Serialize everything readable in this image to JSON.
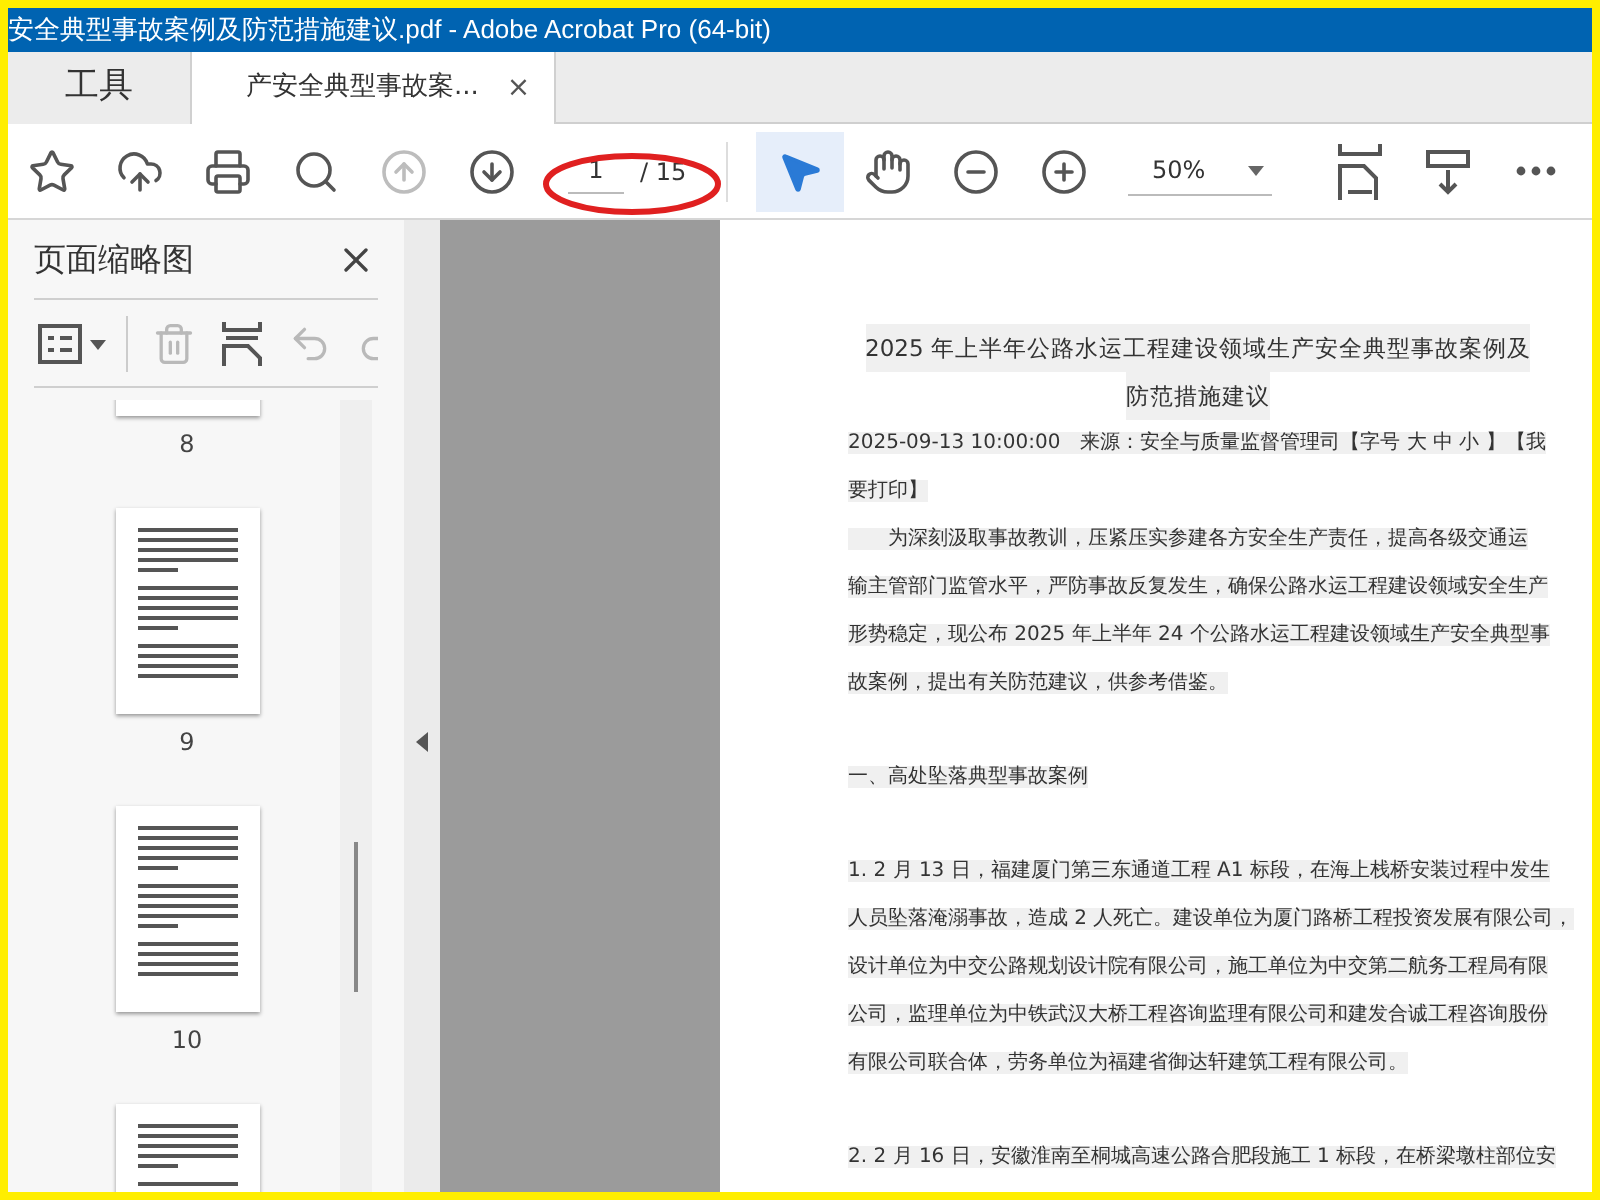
{
  "window": {
    "title": "安全典型事故案例及防范措施建议.pdf - Adobe Acrobat Pro (64-bit)"
  },
  "tabs": [
    {
      "label": "工具",
      "selected": false
    },
    {
      "label": "产安全典型事故案...",
      "selected": true,
      "close": "×"
    }
  ],
  "toolbar": {
    "tools": [
      {
        "kind": "star",
        "selected": false,
        "disabled": false
      },
      {
        "kind": "upload",
        "selected": false,
        "disabled": false
      },
      {
        "kind": "print",
        "selected": false,
        "disabled": false
      },
      {
        "kind": "find",
        "selected": false,
        "disabled": false
      },
      {
        "kind": "previous",
        "selected": false,
        "disabled": true
      },
      {
        "kind": "next",
        "selected": false,
        "disabled": false
      },
      {
        "kind": "select",
        "selected": true,
        "disabled": false
      },
      {
        "kind": "hand",
        "selected": false,
        "disabled": false
      },
      {
        "kind": "zoomout",
        "selected": false,
        "disabled": false
      },
      {
        "kind": "zoomin",
        "selected": false,
        "disabled": false
      },
      {
        "kind": "fit",
        "selected": false,
        "disabled": false
      },
      {
        "kind": "read",
        "selected": false,
        "disabled": false
      },
      {
        "kind": "more",
        "selected": false,
        "disabled": false
      }
    ],
    "page_number": "1",
    "page_total": "/ 15",
    "zoom": "50%"
  },
  "sidebar": {
    "title": "页面缩略图",
    "tools": [
      {
        "kind": "options",
        "disabled": false
      },
      {
        "kind": "delete",
        "disabled": true
      },
      {
        "kind": "insert",
        "disabled": false
      },
      {
        "kind": "undo",
        "disabled": true
      },
      {
        "kind": "redo",
        "disabled": true
      }
    ],
    "thumbnails": [
      {
        "kind": "topcut",
        "label": "8"
      },
      {
        "kind": "whole",
        "label": "9"
      },
      {
        "kind": "whole",
        "label": "10"
      },
      {
        "kind": "bottomcut"
      }
    ]
  },
  "document": {
    "title_lines": [
      "2025 年上半年公路水运工程建设领域生产安全典型事故案例及",
      "防范措施建议"
    ],
    "paragraphs": [
      {
        "kind": "meta",
        "lines": [
          "2025-09-13 10:00:00　来源：安全与质量监督管理司【字号 大 中 小 】【我",
          "要打印】"
        ]
      },
      {
        "kind": "indent",
        "lines": [
          "为深刻汲取事故教训，压紧压实参建各方安全生产责任，提高各级交通运",
          "输主管部门监管水平，严防事故反复发生，确保公路水运工程建设领域安全生产",
          "形势稳定，现公布 2025 年上半年 24 个公路水运工程建设领域生产安全典型事",
          "故案例，提出有关防范建议，供参考借鉴。"
        ]
      },
      {
        "kind": "heading",
        "lines": [
          "一、高处坠落典型事故案例"
        ]
      },
      {
        "kind": "body",
        "lines": [
          "1. 2 月 13 日，福建厦门第三东通道工程 A1 标段，在海上栈桥安装过程中发生",
          "人员坠落淹溺事故，造成 2 人死亡。建设单位为厦门路桥工程投资发展有限公司，",
          "设计单位为中交公路规划设计院有限公司，施工单位为中交第二航务工程局有限",
          "公司，监理单位为中铁武汉大桥工程咨询监理有限公司和建发合诚工程咨询股份",
          "有限公司联合体，劳务单位为福建省御达轩建筑工程有限公司。"
        ]
      },
      {
        "kind": "body",
        "lines": [
          "2. 2 月 16 日，安徽淮南至桐城高速公路合肥段施工 1 标段，在桥梁墩柱部位安"
        ]
      }
    ]
  }
}
